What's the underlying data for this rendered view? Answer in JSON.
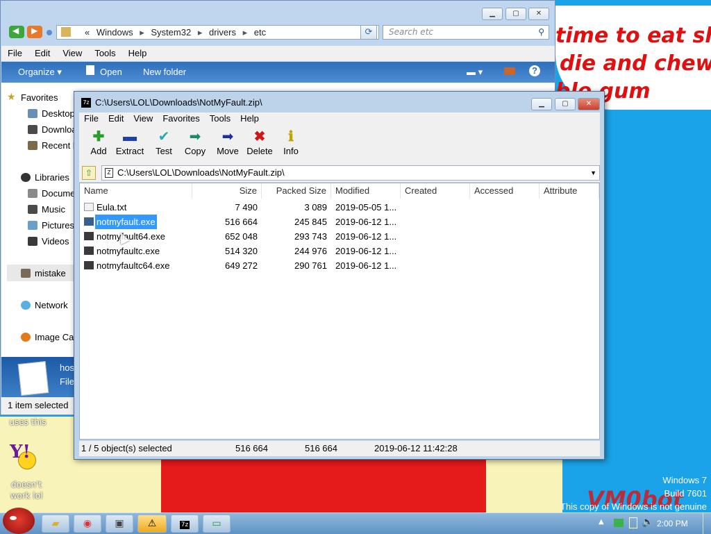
{
  "desktop": {
    "wallpaper_text_1": "time to eat shit",
    "wallpaper_text_2": "die and chew",
    "wallpaper_text_3": "ble gum",
    "uses_this_label": "uses this",
    "icon_label": "doesn't work lol",
    "watermark_line1": "Windows 7",
    "watermark_line2": "Build 7601",
    "watermark_line3": "This copy of Windows is not genuine",
    "vmobot": "VM0bot"
  },
  "explorer": {
    "breadcrumb_prefix": "«",
    "breadcrumb": [
      "Windows",
      "System32",
      "drivers",
      "etc"
    ],
    "search_placeholder": "Search etc",
    "menu": [
      "File",
      "Edit",
      "View",
      "Tools",
      "Help"
    ],
    "commands": {
      "organize": "Organize",
      "open": "Open",
      "new_folder": "New folder"
    },
    "nav": {
      "favorites": "Favorites",
      "desktop": "Desktop",
      "downloads": "Downloa",
      "recent": "Recent P",
      "libraries": "Libraries",
      "documents": "Docume",
      "music": "Music",
      "pictures": "Pictures",
      "videos": "Videos",
      "mistake": "mistake",
      "network": "Network",
      "image_cat": "Image Cat"
    },
    "details_name": "hos",
    "details_type": "File",
    "status": "1 item selected"
  },
  "zip": {
    "title": "C:\\Users\\LOL\\Downloads\\NotMyFault.zip\\",
    "menu": [
      "File",
      "Edit",
      "View",
      "Favorites",
      "Tools",
      "Help"
    ],
    "toolbar": [
      "Add",
      "Extract",
      "Test",
      "Copy",
      "Move",
      "Delete",
      "Info"
    ],
    "address": "C:\\Users\\LOL\\Downloads\\NotMyFault.zip\\",
    "columns": [
      "Name",
      "Size",
      "Packed Size",
      "Modified",
      "Created",
      "Accessed",
      "Attribute"
    ],
    "rows": [
      {
        "name": "Eula.txt",
        "size": "7 490",
        "packed": "3 089",
        "modified": "2019-05-05 1..."
      },
      {
        "name": "notmyfault.exe",
        "size": "516 664",
        "packed": "245 845",
        "modified": "2019-06-12 1..."
      },
      {
        "name": "notmyfault64.exe",
        "size": "652 048",
        "packed": "293 743",
        "modified": "2019-06-12 1..."
      },
      {
        "name": "notmyfaultc.exe",
        "size": "514 320",
        "packed": "244 976",
        "modified": "2019-06-12 1..."
      },
      {
        "name": "notmyfaultc64.exe",
        "size": "649 272",
        "packed": "290 761",
        "modified": "2019-06-12 1..."
      }
    ],
    "selected_row": 1,
    "status": {
      "count": "1 / 5 object(s) selected",
      "size": "516 664",
      "packed": "516 664",
      "modified": "2019-06-12 11:42:28"
    }
  },
  "taskbar": {
    "clock": "2:00 PM",
    "items": [
      "explorer-icon",
      "chrome-icon",
      "network-icon",
      "warning-icon",
      "7zip-icon",
      "battery-icon"
    ]
  }
}
